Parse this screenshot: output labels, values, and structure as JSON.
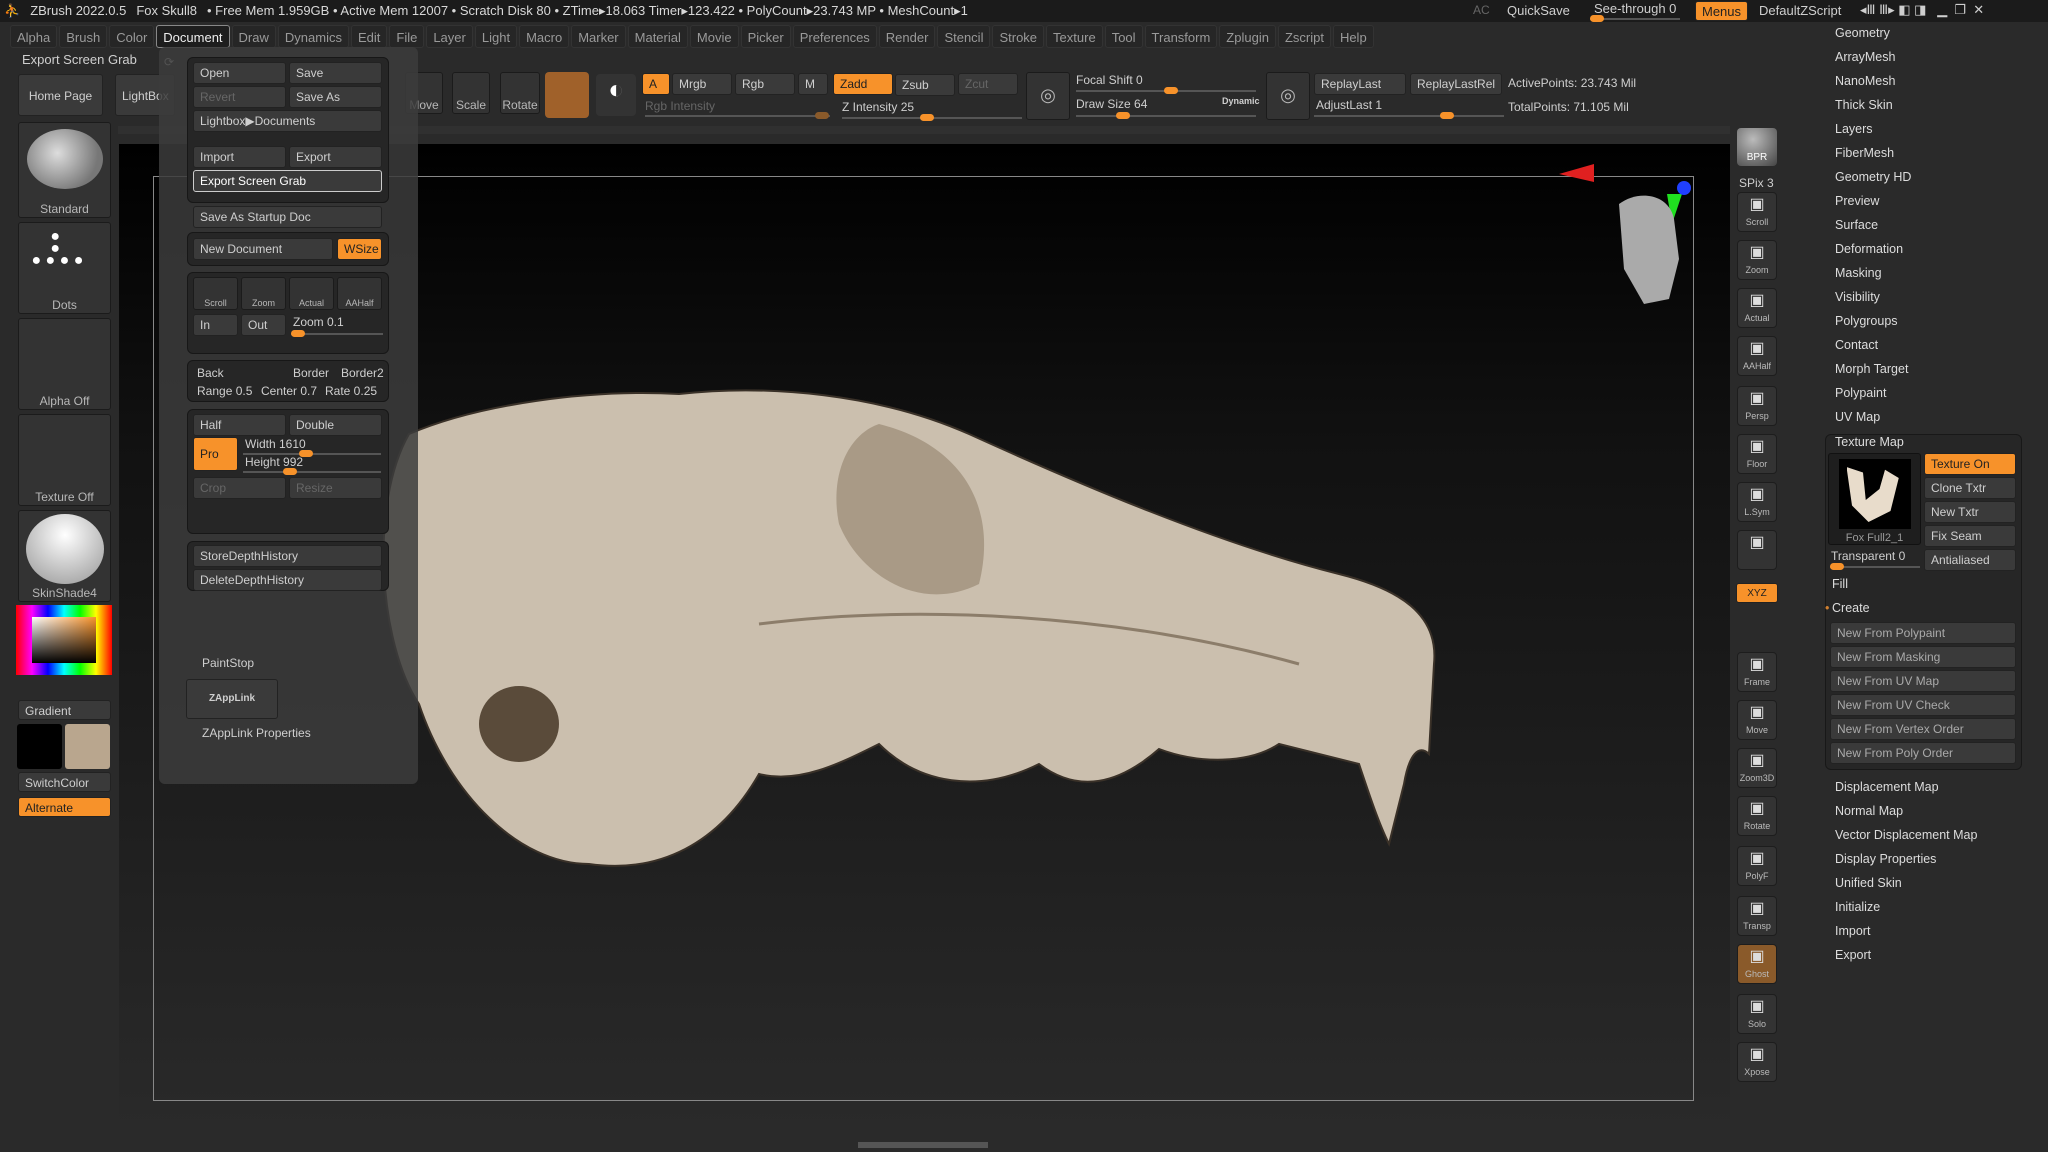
{
  "title": {
    "app": "ZBrush 2022.0.5",
    "doc": "Fox Skull8",
    "stats": "• Free Mem 1.959GB • Active Mem 12007 • Scratch Disk 80 • ZTime▸18.063 Timer▸123.422 • PolyCount▸23.743 MP • MeshCount▸1",
    "ac": "AC",
    "quicksave": "QuickSave",
    "seethrough": "See-through  0",
    "menus": "Menus",
    "defaultzscript": "DefaultZScript"
  },
  "menus": [
    "Alpha",
    "Brush",
    "Color",
    "Document",
    "Draw",
    "Dynamics",
    "Edit",
    "File",
    "Layer",
    "Light",
    "Macro",
    "Marker",
    "Material",
    "Movie",
    "Picker",
    "Preferences",
    "Render",
    "Stencil",
    "Stroke",
    "Texture",
    "Tool",
    "Transform",
    "Zplugin",
    "Zscript",
    "Help"
  ],
  "active_menu": "Document",
  "tooltip": "Export Screen Grab",
  "left": {
    "home": "Home Page",
    "lightbox": "LightBox",
    "brush": "Standard",
    "stroke": "Dots",
    "alpha": "Alpha Off",
    "texture": "Texture Off",
    "material": "SkinShade4",
    "gradient": "Gradient",
    "switchcolor": "SwitchColor",
    "alternate": "Alternate",
    "colors": {
      "main": "#000000",
      "secondary": "#b9a68e",
      "accent": "#f7922a"
    }
  },
  "toolbar": {
    "move": "Move",
    "scale": "Scale",
    "rotate": "Rotate",
    "a": "A",
    "mrgb": "Mrgb",
    "rgb": "Rgb",
    "m": "M",
    "zadd": "Zadd",
    "zsub": "Zsub",
    "zcut": "Zcut",
    "rgb_intensity": "Rgb Intensity",
    "z_intensity": "Z Intensity 25",
    "focal_shift": "Focal Shift 0",
    "draw_size": "Draw Size 64",
    "dynamic": "Dynamic",
    "replay_last": "ReplayLast",
    "replay_last_rel": "ReplayLastRel",
    "adjust_last": "AdjustLast 1",
    "active_points": "ActivePoints: 23.743 Mil",
    "total_points": "TotalPoints: 71.105 Mil"
  },
  "document": {
    "open": "Open",
    "save": "Save",
    "revert": "Revert",
    "save_as": "Save As",
    "lightbox_docs": "Lightbox▶Documents",
    "import": "Import",
    "export": "Export",
    "export_screen_grab": "Export Screen Grab",
    "save_startup": "Save As Startup Doc",
    "new_document": "New Document",
    "wsize": "WSize",
    "scroll": "Scroll",
    "zoom": "Zoom",
    "actual": "Actual",
    "aahalf": "AAHalf",
    "in": "In",
    "out": "Out",
    "zoom_value": "Zoom 0.1",
    "back": "Back",
    "border": "Border",
    "border2": "Border2",
    "range": "Range 0.5",
    "center": "Center 0.7",
    "rate": "Rate 0.25",
    "half": "Half",
    "double": "Double",
    "pro": "Pro",
    "width": "Width 1610",
    "height": "Height 992",
    "crop": "Crop",
    "resize": "Resize",
    "store_depth": "StoreDepthHistory",
    "delete_depth": "DeleteDepthHistory",
    "paintstop": "PaintStop",
    "zapplink": "ZAppLink",
    "zapplink_props": "ZAppLink Properties"
  },
  "shelf": {
    "bpr": "BPR",
    "spix": "SPix 3",
    "items": [
      "Scroll",
      "Zoom",
      "Actual",
      "AAHalf",
      "Persp",
      "Floor",
      "L.Sym",
      "",
      "Frame",
      "Move",
      "Zoom3D",
      "Rotate",
      "PolyF",
      "Transp",
      "Ghost",
      "Solo",
      "Xpose"
    ],
    "xyz": "XYZ"
  },
  "right": {
    "items_top": [
      "Geometry",
      "ArrayMesh",
      "NanoMesh",
      "Thick Skin",
      "Layers",
      "FiberMesh",
      "Geometry HD",
      "Preview",
      "Surface",
      "Deformation",
      "Masking",
      "Visibility",
      "Polygroups",
      "Contact",
      "Morph Target",
      "Polypaint",
      "UV Map"
    ],
    "texture_map": {
      "title": "Texture Map",
      "thumb": "Fox Full2_1",
      "texture_on": "Texture On",
      "clone": "Clone Txtr",
      "new": "New Txtr",
      "fix_seam": "Fix Seam",
      "transparent": "Transparent 0",
      "antialiased": "Antialiased",
      "fill": "Fill",
      "create": "Create",
      "create_items": [
        "New From Polypaint",
        "New From Masking",
        "New From UV Map",
        "New From UV Check",
        "New From Vertex Order",
        "New From Poly Order"
      ]
    },
    "items_bottom": [
      "Displacement Map",
      "Normal Map",
      "Vector Displacement Map",
      "Display Properties",
      "Unified Skin",
      "Initialize",
      "Import",
      "Export"
    ]
  }
}
